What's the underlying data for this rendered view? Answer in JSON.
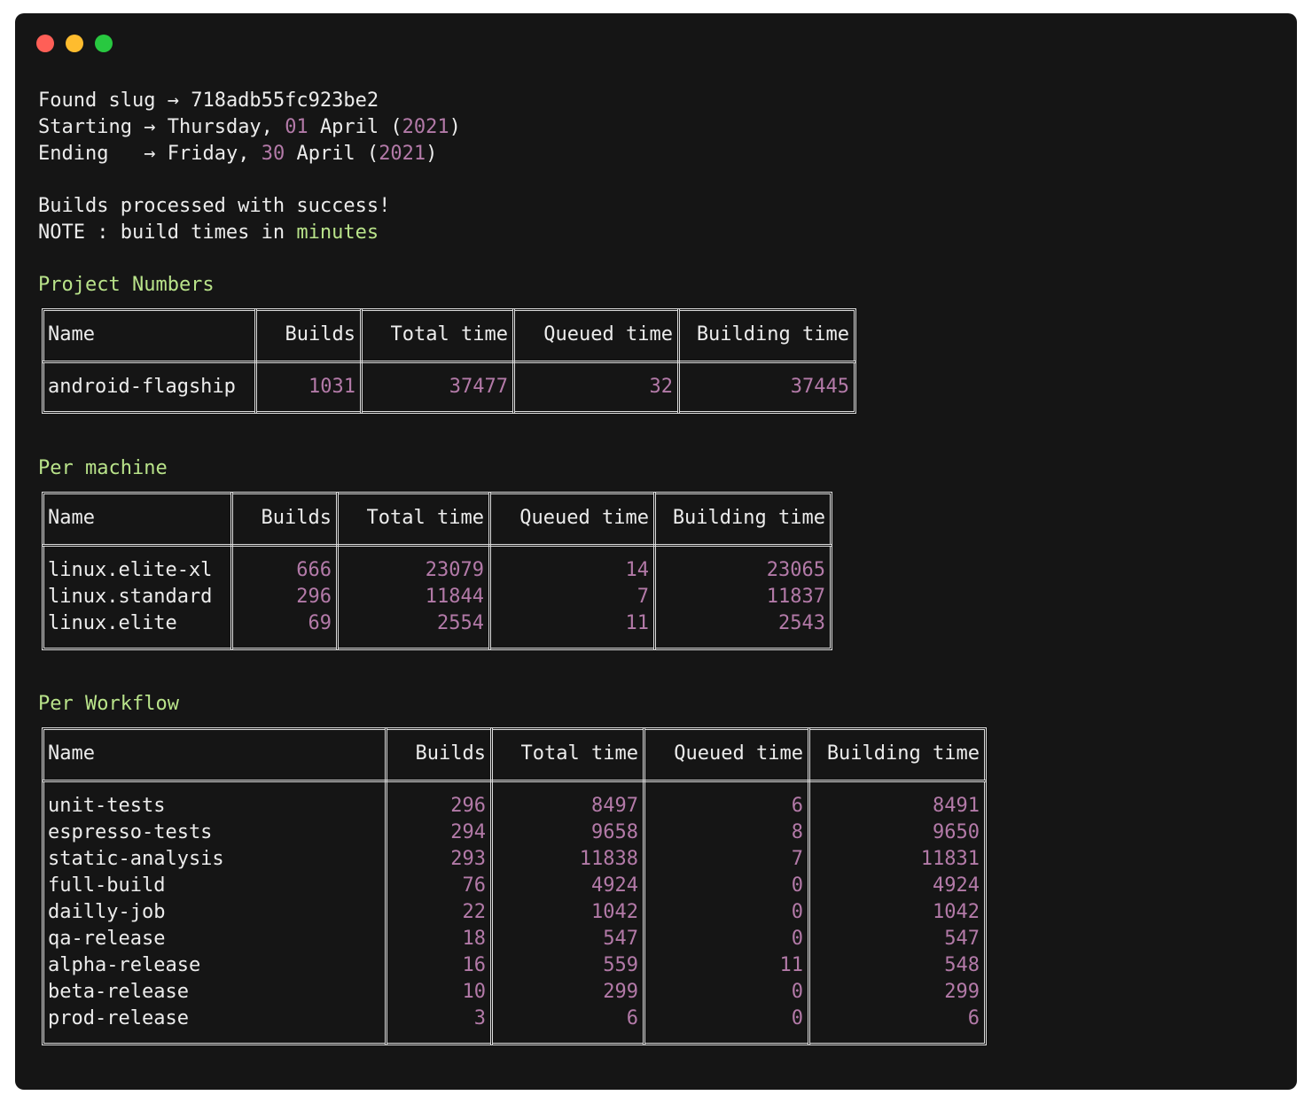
{
  "window": {
    "traffic_lights": [
      "close",
      "minimize",
      "maximize"
    ],
    "colors": {
      "background": "#151515",
      "text": "#ececec",
      "number": "#b37aa8",
      "accent": "#b9e38a",
      "close": "#ff5f57",
      "minimize": "#febc2e",
      "maximize": "#28c840"
    }
  },
  "header": {
    "found": {
      "label": "Found slug",
      "arrow": "→",
      "value": "718adb55fc923be2"
    },
    "starting": {
      "label": "Starting",
      "arrow": "→",
      "weekday": "Thursday,",
      "day": "01",
      "month": "April",
      "year": "2021"
    },
    "ending": {
      "label": "Ending",
      "arrow": "→",
      "weekday": "Friday,",
      "day": "30",
      "month": "April",
      "year": "2021"
    },
    "success": "Builds processed with success!",
    "note_prefix": "NOTE : build times in",
    "note_unit": "minutes"
  },
  "columns": [
    "Name",
    "Builds",
    "Total time",
    "Queued time",
    "Building time"
  ],
  "project_numbers": {
    "title": "Project Numbers",
    "rows": [
      [
        "android-flagship",
        "1031",
        "37477",
        "32",
        "37445"
      ]
    ]
  },
  "per_machine": {
    "title": "Per machine",
    "rows": [
      [
        "linux.elite-xl",
        "666",
        "23079",
        "14",
        "23065"
      ],
      [
        "linux.standard",
        "296",
        "11844",
        "7",
        "11837"
      ],
      [
        "linux.elite",
        "69",
        "2554",
        "11",
        "2543"
      ]
    ]
  },
  "per_workflow": {
    "title": "Per Workflow",
    "rows": [
      [
        "unit-tests",
        "296",
        "8497",
        "6",
        "8491"
      ],
      [
        "espresso-tests",
        "294",
        "9658",
        "8",
        "9650"
      ],
      [
        "static-analysis",
        "293",
        "11838",
        "7",
        "11831"
      ],
      [
        "full-build",
        "76",
        "4924",
        "0",
        "4924"
      ],
      [
        "dailly-job",
        "22",
        "1042",
        "0",
        "1042"
      ],
      [
        "qa-release",
        "18",
        "547",
        "0",
        "547"
      ],
      [
        "alpha-release",
        "16",
        "559",
        "11",
        "548"
      ],
      [
        "beta-release",
        "10",
        "299",
        "0",
        "299"
      ],
      [
        "prod-release",
        "3",
        "6",
        "0",
        "6"
      ]
    ]
  }
}
